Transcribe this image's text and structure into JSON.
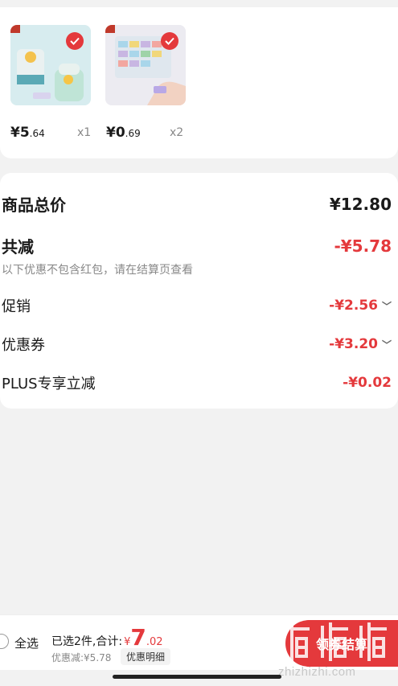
{
  "products": [
    {
      "price_int": "¥5",
      "price_dec": ".64",
      "qty": "x1",
      "selected": true
    },
    {
      "price_int": "¥0",
      "price_dec": ".69",
      "qty": "x2",
      "selected": true
    }
  ],
  "summary": {
    "total_label": "商品总价",
    "total_value": "¥12.80",
    "discount_label": "共减",
    "discount_value": "-¥5.78",
    "note": "以下优惠不包含红包，请在结算页查看",
    "promo_label": "促销",
    "promo_value": "-¥2.56",
    "coupon_label": "优惠券",
    "coupon_value": "-¥3.20",
    "plus_label": "PLUS专享立减",
    "plus_value": "-¥0.02"
  },
  "bottom": {
    "select_all": "全选",
    "selected_count": "已选2件,合计:",
    "currency": "¥",
    "total_int": "7",
    "total_dec": ".02",
    "saving": "优惠减:¥5.78",
    "detail_button": "优惠明细",
    "checkout_button": "领券结算"
  },
  "watermark": "zhizhizhi.com",
  "colors": {
    "accent": "#e4393c"
  }
}
